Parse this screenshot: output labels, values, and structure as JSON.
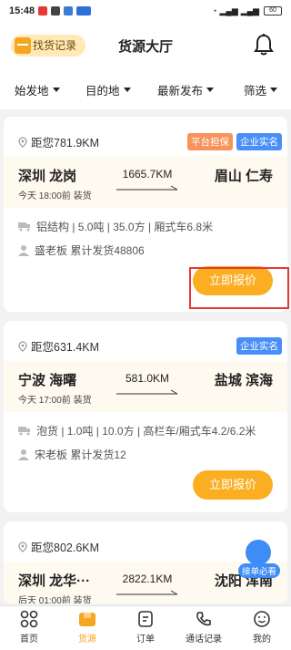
{
  "status_bar": {
    "time": "15:48",
    "battery": "60"
  },
  "header": {
    "logo_label": "找货记录",
    "title": "货源大厅"
  },
  "filters": [
    {
      "label": "始发地"
    },
    {
      "label": "目的地"
    },
    {
      "label": "最新发布"
    },
    {
      "label": "筛选"
    }
  ],
  "cards": [
    {
      "distance": "距您781.9KM",
      "tags": [
        "平台担保",
        "企业实名"
      ],
      "origin": "深圳 龙岗",
      "destination": "眉山 仁寿",
      "load_time": "今天 18:00前 装货",
      "route_km": "1665.7KM",
      "goods": "铝结构 | 5.0吨 | 35.0方 | 厢式车6.8米",
      "shipper": "盛老板  累计发货48806",
      "button": "立即报价"
    },
    {
      "distance": "距您631.4KM",
      "tags": [
        "企业实名"
      ],
      "origin": "宁波 海曙",
      "destination": "盐城 滨海",
      "load_time": "今天 17:00前 装货",
      "route_km": "581.0KM",
      "goods": "泡货 | 1.0吨 | 10.0方 | 高栏车/厢式车4.2/6.2米",
      "shipper": "宋老板  累计发货12",
      "button": "立即报价"
    },
    {
      "distance": "距您802.6KM",
      "origin": "深圳 龙华···",
      "destination": "沈阳 浑南",
      "load_time": "后天 01:00前 装货",
      "route_km": "2822.1KM"
    }
  ],
  "floating_badge": {
    "label": "接单必看"
  },
  "tabbar": [
    {
      "label": "首页"
    },
    {
      "label": "货源"
    },
    {
      "label": "订单"
    },
    {
      "label": "通话记录"
    },
    {
      "label": "我的"
    }
  ],
  "colors": {
    "accent": "#fbae22",
    "blue_tag": "#4a8ff7",
    "orange_tag": "#f7935b",
    "highlight": "#e53935"
  }
}
